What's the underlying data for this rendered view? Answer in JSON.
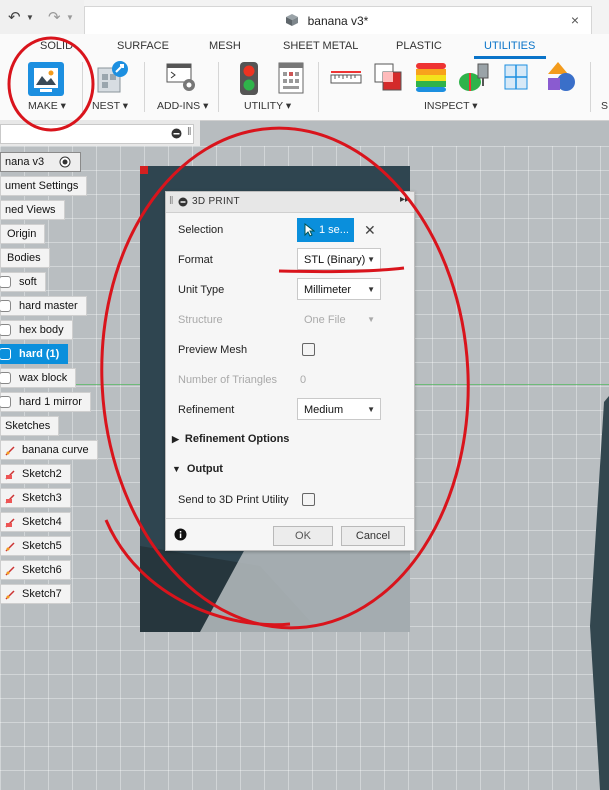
{
  "app": {
    "document_title": "banana v3*",
    "undo_glyph": "↶",
    "redo_glyph": "↷",
    "close_glyph": "×"
  },
  "ribbon": {
    "tabs": [
      "SOLID",
      "SURFACE",
      "MESH",
      "SHEET METAL",
      "PLASTIC",
      "UTILITIES"
    ],
    "active_tab": "UTILITIES",
    "groups": [
      "MAKE ▾",
      "NEST ▾",
      "ADD-INS ▾",
      "UTILITY ▾",
      "INSPECT ▾",
      "S"
    ]
  },
  "browser": {
    "root": "nana v3",
    "items": [
      "ument Settings",
      "ned Views",
      "Origin",
      "Bodies",
      "soft",
      "hard master",
      "hex body",
      "hard (1)",
      "wax block",
      "hard 1 mirror",
      "Sketches",
      "banana curve",
      "Sketch2",
      "Sketch3",
      "Sketch4",
      "Sketch5",
      "Sketch6",
      "Sketch7"
    ]
  },
  "dialog": {
    "title": "3D PRINT",
    "selection_label": "Selection",
    "selection_value": "1 se...",
    "format_label": "Format",
    "format_value": "STL (Binary)",
    "unit_label": "Unit Type",
    "unit_value": "Millimeter",
    "structure_label": "Structure",
    "structure_value": "One File",
    "preview_label": "Preview Mesh",
    "triangles_label": "Number of Triangles",
    "triangles_value": "0",
    "refinement_label": "Refinement",
    "refinement_value": "Medium",
    "refinement_options_label": "Refinement Options",
    "output_label": "Output",
    "send_label": "Send to 3D Print Utility",
    "ok_label": "OK",
    "cancel_label": "Cancel",
    "info_glyph": "i"
  },
  "colors": {
    "accent": "#0a8fdc",
    "annotation_red": "#d9141c"
  }
}
